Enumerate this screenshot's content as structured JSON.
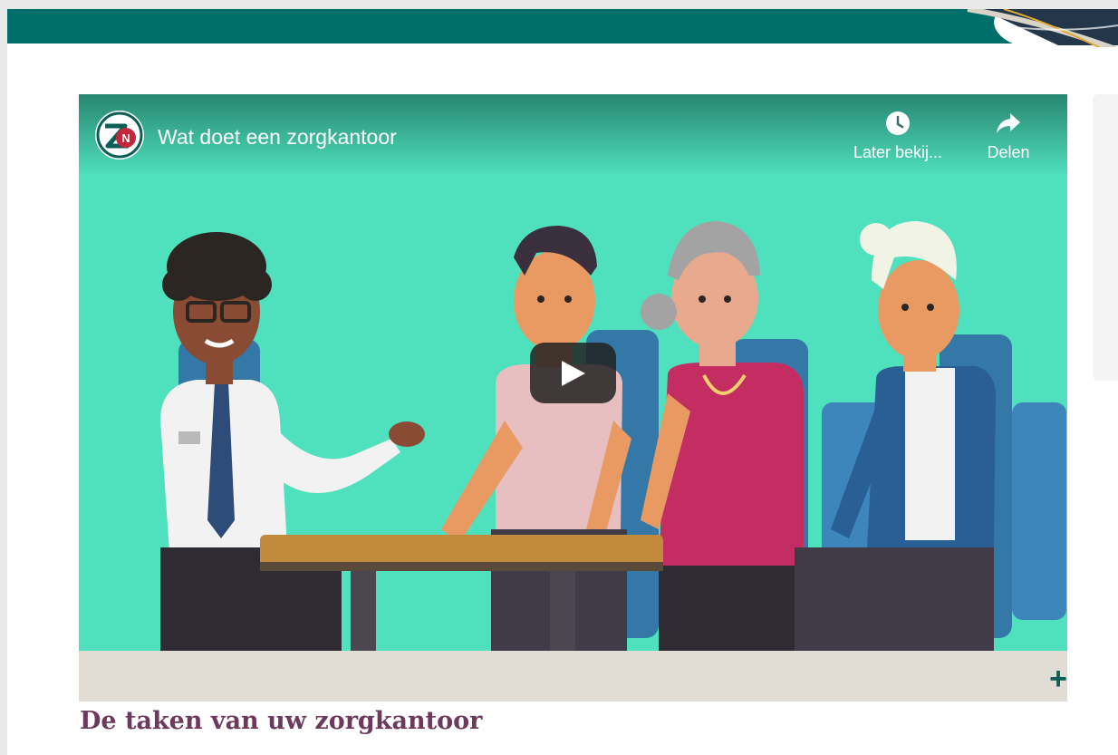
{
  "colors": {
    "banner_teal": "#006f69",
    "video_background": "#4fe0bd",
    "heading_color": "#6d3a5d",
    "caption_bar": "#e1ddd5",
    "plus_color": "#0b5d55"
  },
  "video": {
    "title": "Wat doet een zorgkantoor",
    "channel_icon": "zn-logo-icon",
    "actions": [
      {
        "label": "Later bekij...",
        "icon": "clock-icon"
      },
      {
        "label": "Delen",
        "icon": "share-arrow-icon"
      }
    ],
    "play_icon": "play-icon"
  },
  "expand_icon": "plus-icon",
  "expand_symbol": "+",
  "section": {
    "heading": "De taken van uw zorgkantoor"
  }
}
